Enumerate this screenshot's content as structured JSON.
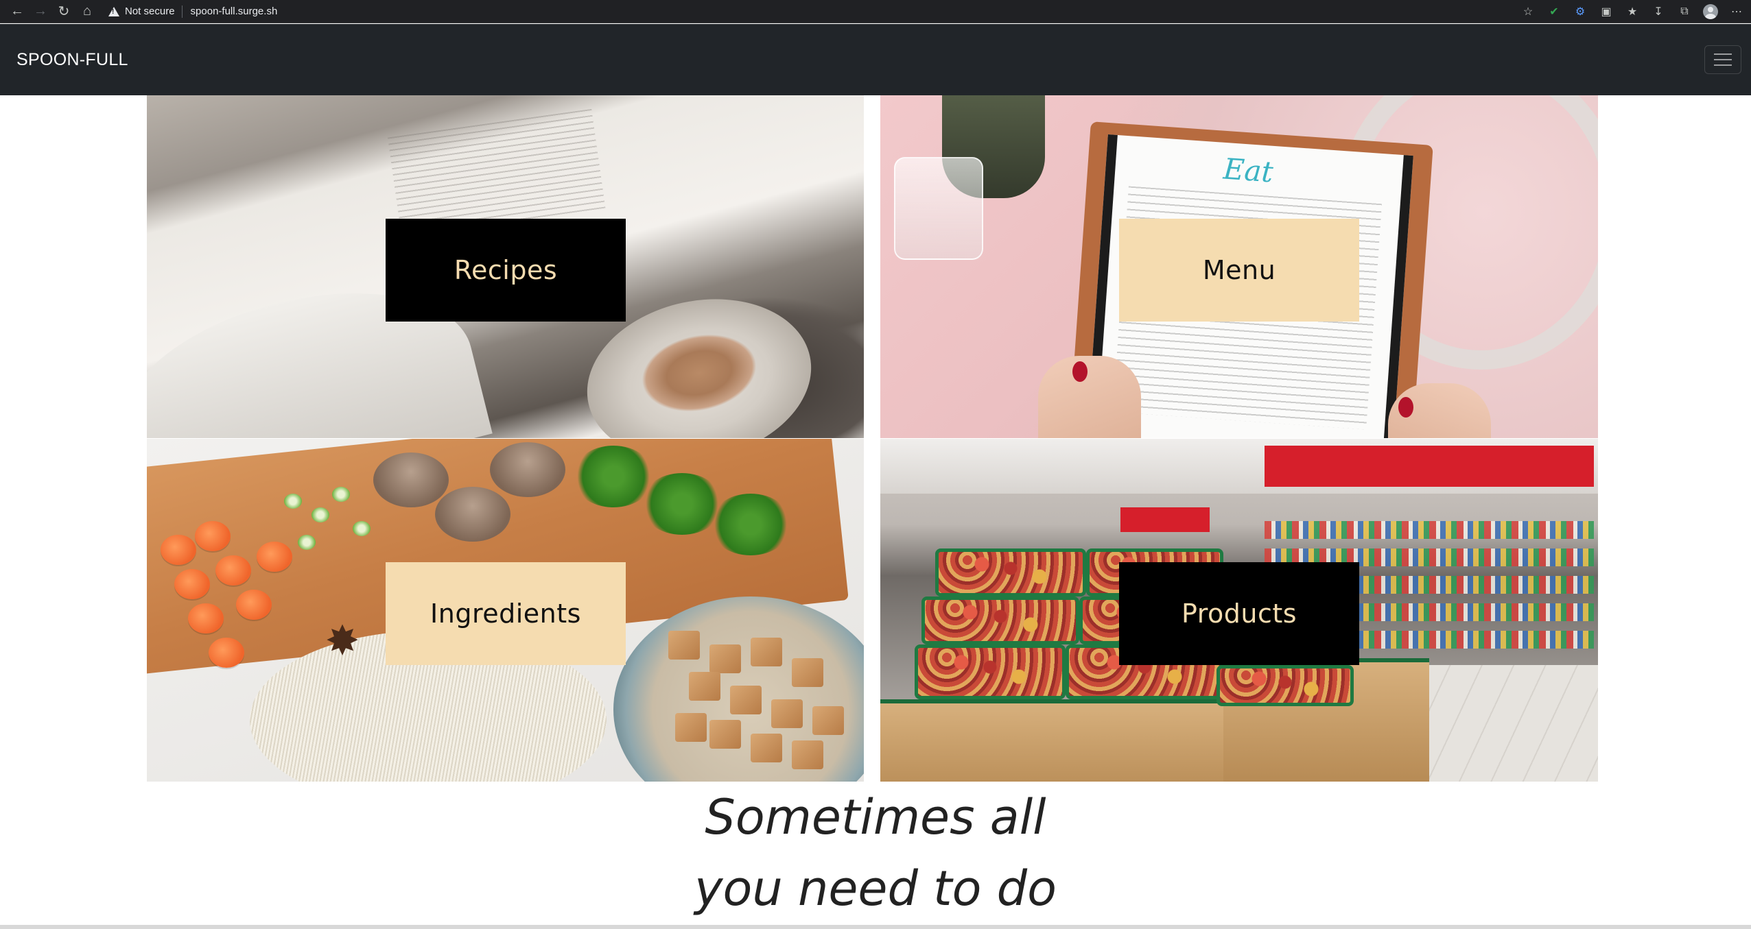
{
  "browser": {
    "security_label": "Not secure",
    "url": "spoon-full.surge.sh",
    "icons": [
      "back-arrow-icon",
      "forward-arrow-icon",
      "reload-icon",
      "home-icon",
      "warning-icon",
      "bookmark-star-icon",
      "extension-check-icon",
      "extension-gear-icon",
      "extension-icon",
      "favorites-icon",
      "downloads-icon",
      "collections-icon",
      "profile-icon",
      "more-icon"
    ]
  },
  "navbar": {
    "brand": "SPOON-FULL",
    "toggler_icon": "hamburger-menu-icon",
    "bg_color": "#212529"
  },
  "tiles": [
    {
      "label": "Recipes",
      "style": "dark"
    },
    {
      "label": "Menu",
      "style": "light"
    },
    {
      "label": "Ingredients",
      "style": "light"
    },
    {
      "label": "Products",
      "style": "dark"
    }
  ],
  "menu_card": {
    "title": "Eat"
  },
  "colors": {
    "label_cream": "#f5dcb0",
    "label_black": "#000000"
  },
  "quote": {
    "line1": "Sometimes all",
    "line2": "you need to do"
  }
}
